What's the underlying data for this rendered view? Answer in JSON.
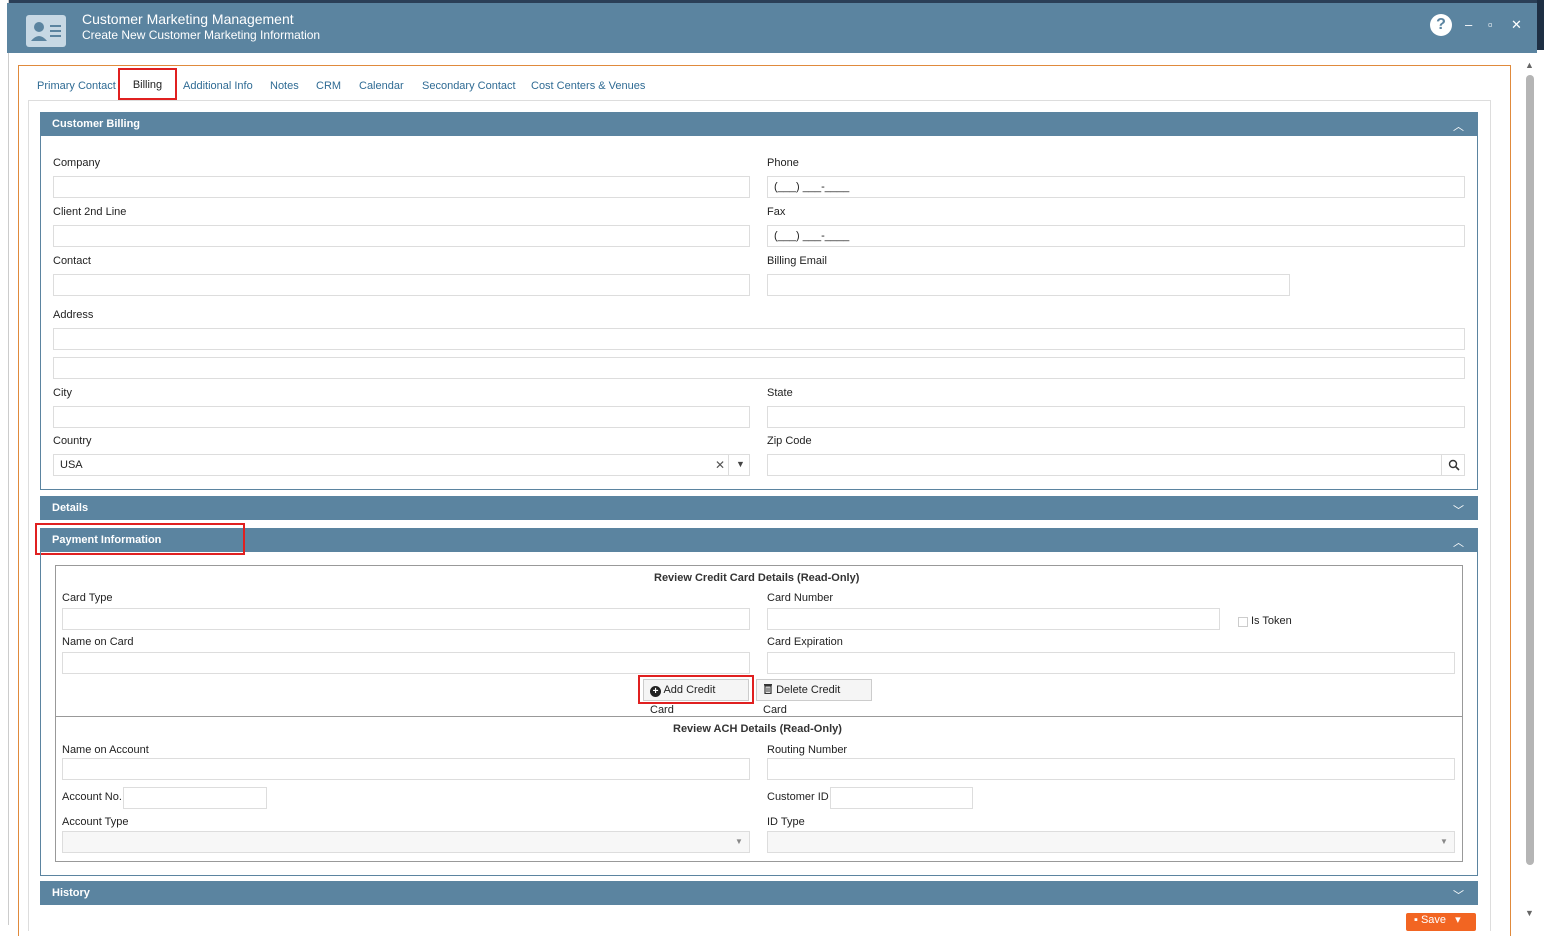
{
  "window": {
    "title": "Customer Marketing Management",
    "subtitle": "Create New Customer Marketing Information",
    "help_glyph": "?",
    "minimize_glyph": "–",
    "maximize_glyph": "▫",
    "close_glyph": "✕"
  },
  "tabs": [
    {
      "label": "Primary Contact"
    },
    {
      "label": "Billing"
    },
    {
      "label": "Additional Info"
    },
    {
      "label": "Notes"
    },
    {
      "label": "CRM"
    },
    {
      "label": "Calendar"
    },
    {
      "label": "Secondary Contact"
    },
    {
      "label": "Cost Centers & Venues"
    }
  ],
  "customer_billing": {
    "title": "Customer Billing",
    "company_label": "Company",
    "phone_label": "Phone",
    "phone_mask": "(___) ___-____",
    "client2_label": "Client 2nd Line",
    "fax_label": "Fax",
    "fax_mask": "(___) ___-____",
    "contact_label": "Contact",
    "billing_email_label": "Billing Email",
    "address_label": "Address",
    "city_label": "City",
    "state_label": "State",
    "country_label": "Country",
    "country_value": "USA",
    "zip_label": "Zip Code"
  },
  "details": {
    "title": "Details"
  },
  "payment": {
    "title": "Payment Information",
    "cc_title": "Review Credit Card Details (Read-Only)",
    "card_type_label": "Card Type",
    "card_number_label": "Card Number",
    "is_token_label": "Is Token",
    "name_on_card_label": "Name on Card",
    "card_expiration_label": "Card Expiration",
    "add_card_label": "Add Credit Card",
    "delete_card_label": "Delete Credit Card",
    "ach_title": "Review ACH Details (Read-Only)",
    "name_on_account_label": "Name on Account",
    "routing_number_label": "Routing Number",
    "account_no_label": "Account No.",
    "customer_id_label": "Customer ID",
    "account_type_label": "Account Type",
    "id_type_label": "ID Type"
  },
  "history": {
    "title": "History"
  },
  "footer": {
    "save_label": "Save"
  },
  "colors": {
    "panel_header": "#5b84a0",
    "tab_link": "#2f6b94",
    "highlight": "#e02020",
    "save_button": "#f26522"
  }
}
